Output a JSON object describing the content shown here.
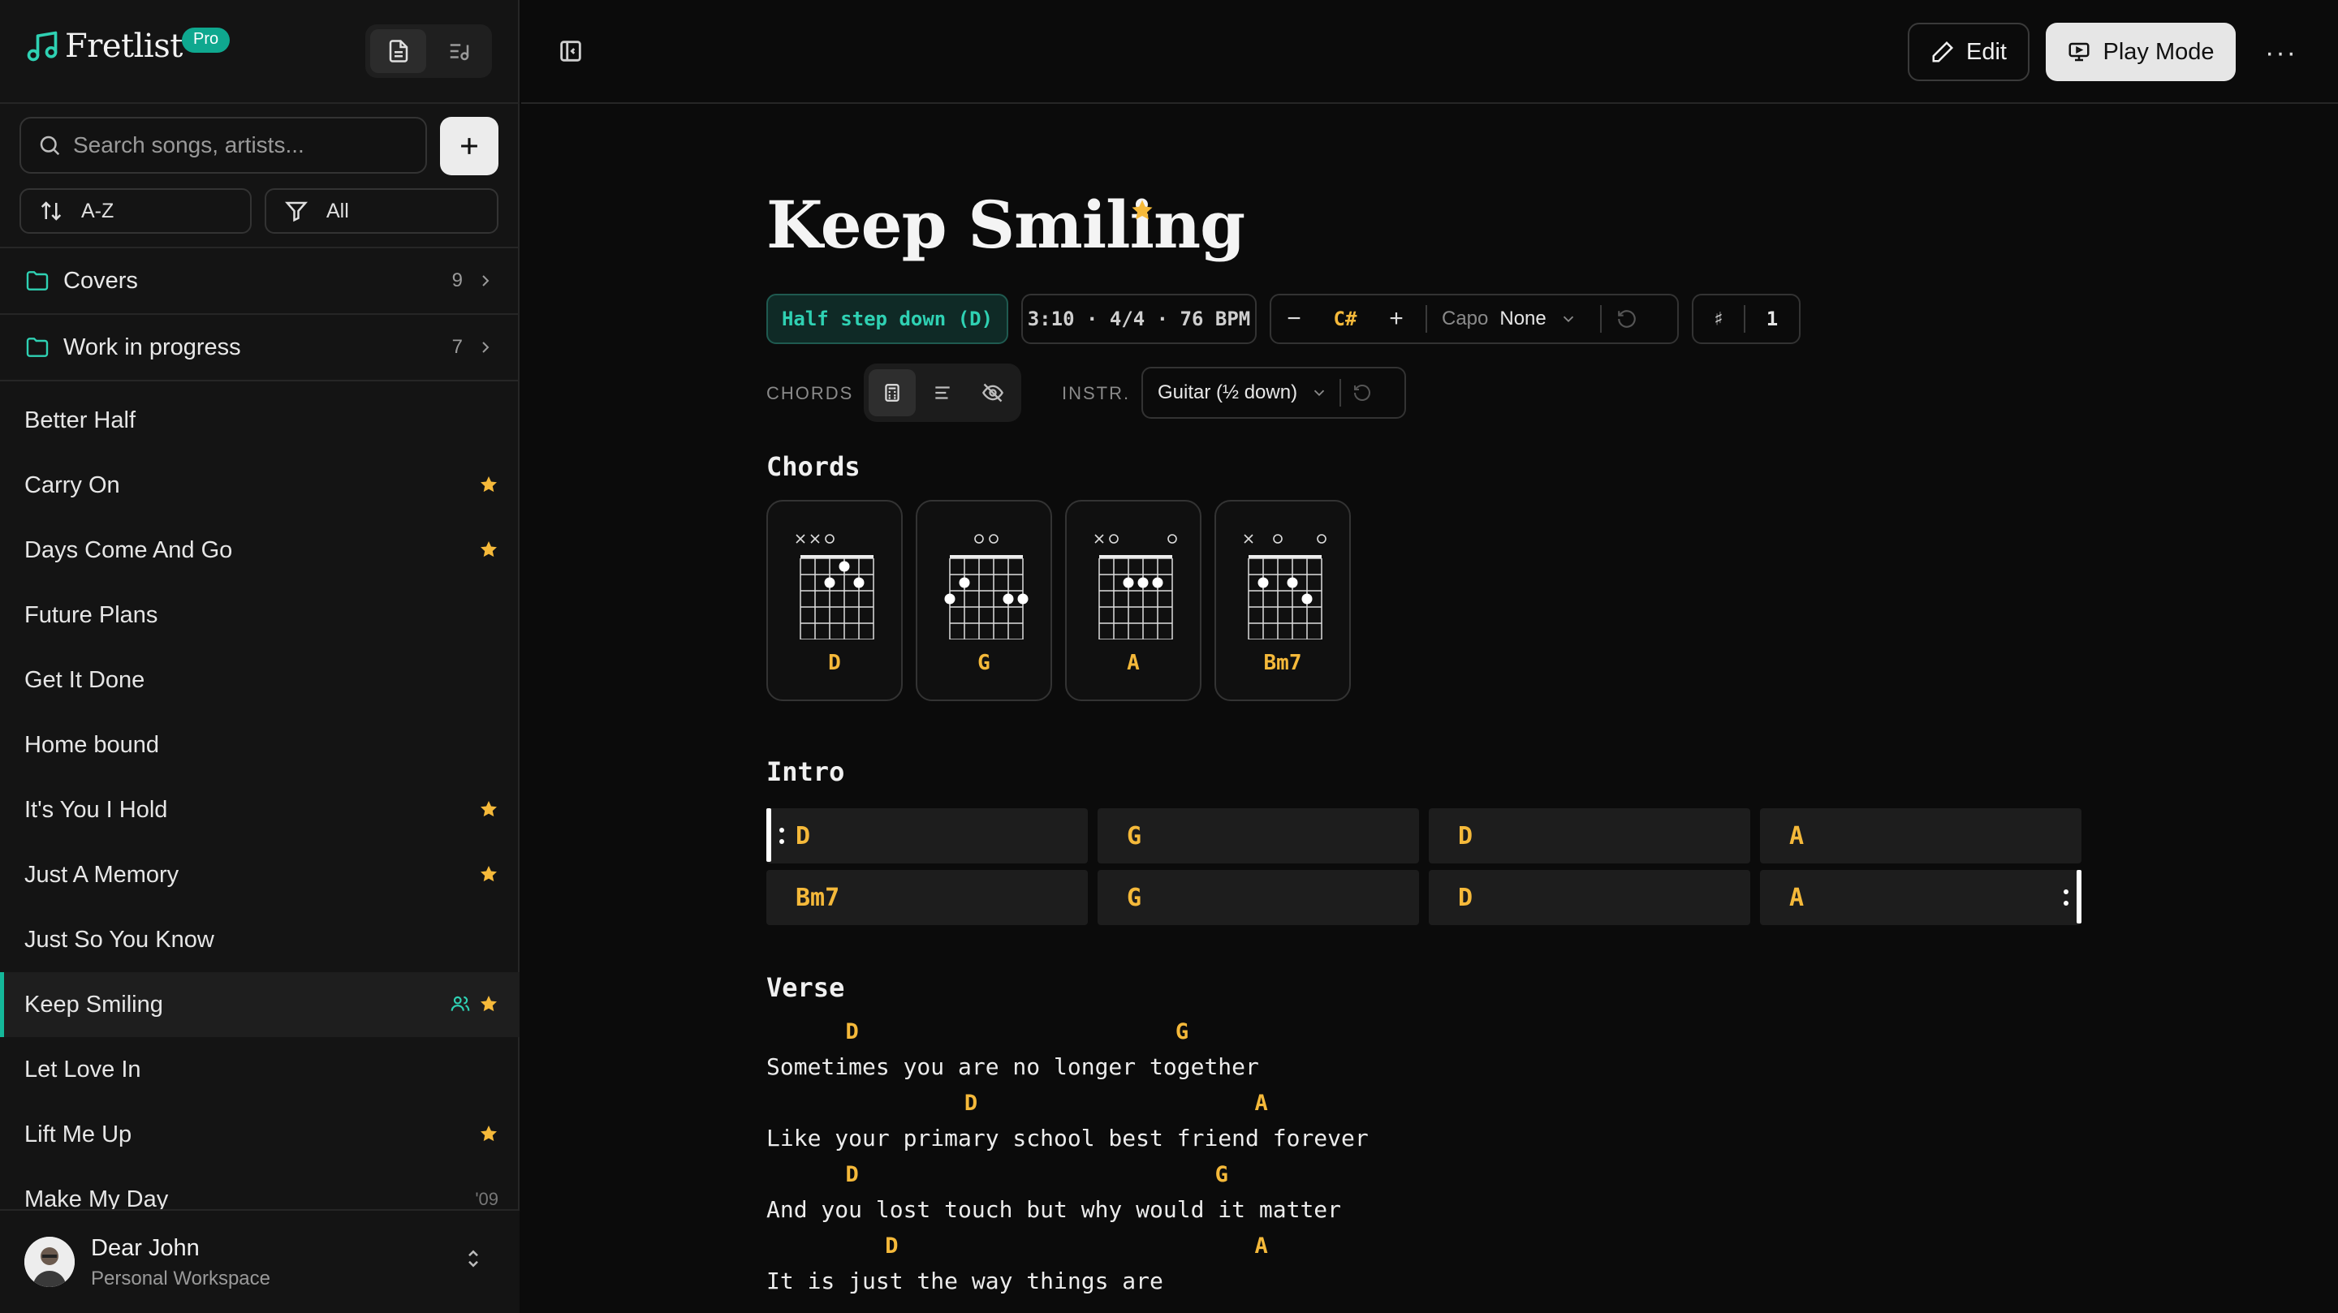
{
  "app": {
    "name": "Fretlist",
    "badge": "Pro"
  },
  "sidebar": {
    "search_placeholder": "Search songs, artists...",
    "sort_label": "A-Z",
    "filter_label": "All",
    "folders": [
      {
        "name": "Covers",
        "count": "9"
      },
      {
        "name": "Work in progress",
        "count": "7"
      }
    ],
    "songs": [
      {
        "title": "Better Half",
        "starred": false
      },
      {
        "title": "Carry On",
        "starred": true
      },
      {
        "title": "Days Come And Go",
        "starred": true
      },
      {
        "title": "Future Plans",
        "starred": false
      },
      {
        "title": "Get It Done",
        "starred": false
      },
      {
        "title": "Home bound",
        "starred": false
      },
      {
        "title": "It's You I Hold",
        "starred": true
      },
      {
        "title": "Just A Memory",
        "starred": true
      },
      {
        "title": "Just So You Know",
        "starred": false
      },
      {
        "title": "Keep Smiling",
        "starred": true,
        "shared": true,
        "active": true
      },
      {
        "title": "Let Love In",
        "starred": false
      },
      {
        "title": "Lift Me Up",
        "starred": true
      },
      {
        "title": "Make My Day",
        "starred": false,
        "year": "'09"
      }
    ],
    "user": {
      "name": "Dear John",
      "workspace": "Personal Workspace"
    }
  },
  "topbar": {
    "edit_label": "Edit",
    "play_label": "Play Mode",
    "more_label": "···"
  },
  "song": {
    "title": "Keep Smiling",
    "tuning": "Half step down (D)",
    "meta": "3:10 · 4/4 · 76 BPM",
    "key": "C#",
    "capo_label": "Capo",
    "capo_value": "None",
    "sharp_symbol": "♯",
    "sharp_count": "1",
    "chords_label": "CHORDS",
    "instr_label": "INSTR.",
    "instrument": "Guitar (½ down)"
  },
  "sections": {
    "chords_title": "Chords",
    "chords": [
      {
        "name": "D",
        "markers": "××o   ",
        "dots": [
          [
            1,
            4
          ],
          [
            2,
            3
          ],
          [
            2,
            5
          ]
        ]
      },
      {
        "name": "G",
        "markers": "  oo  ",
        "dots": [
          [
            2,
            2
          ],
          [
            3,
            1
          ],
          [
            3,
            5
          ],
          [
            3,
            6
          ]
        ]
      },
      {
        "name": "A",
        "markers": "×o   o",
        "dots": [
          [
            2,
            3
          ],
          [
            2,
            4
          ],
          [
            2,
            5
          ]
        ]
      },
      {
        "name": "Bm7",
        "markers": "× o  o",
        "dots": [
          [
            2,
            2
          ],
          [
            2,
            4
          ],
          [
            3,
            5
          ]
        ]
      }
    ],
    "intro_title": "Intro",
    "intro_bars": [
      [
        "D",
        "G",
        "D",
        "A"
      ],
      [
        "Bm7",
        "G",
        "D",
        "A"
      ]
    ],
    "verse_title": "Verse",
    "verse": [
      {
        "chords": "  D        G",
        "lyric": "Sometimes you are no longer together"
      },
      {
        "chords": "     D       A",
        "lyric": "Like your primary school best friend forever"
      },
      {
        "chords": "  D         G",
        "lyric": "And you lost touch but why would it matter"
      },
      {
        "chords": "   D         A",
        "lyric": "It is just the way things are"
      }
    ]
  },
  "colors": {
    "accent": "#14b89a",
    "chord": "#f5b93a",
    "star": "#f5b93a"
  }
}
